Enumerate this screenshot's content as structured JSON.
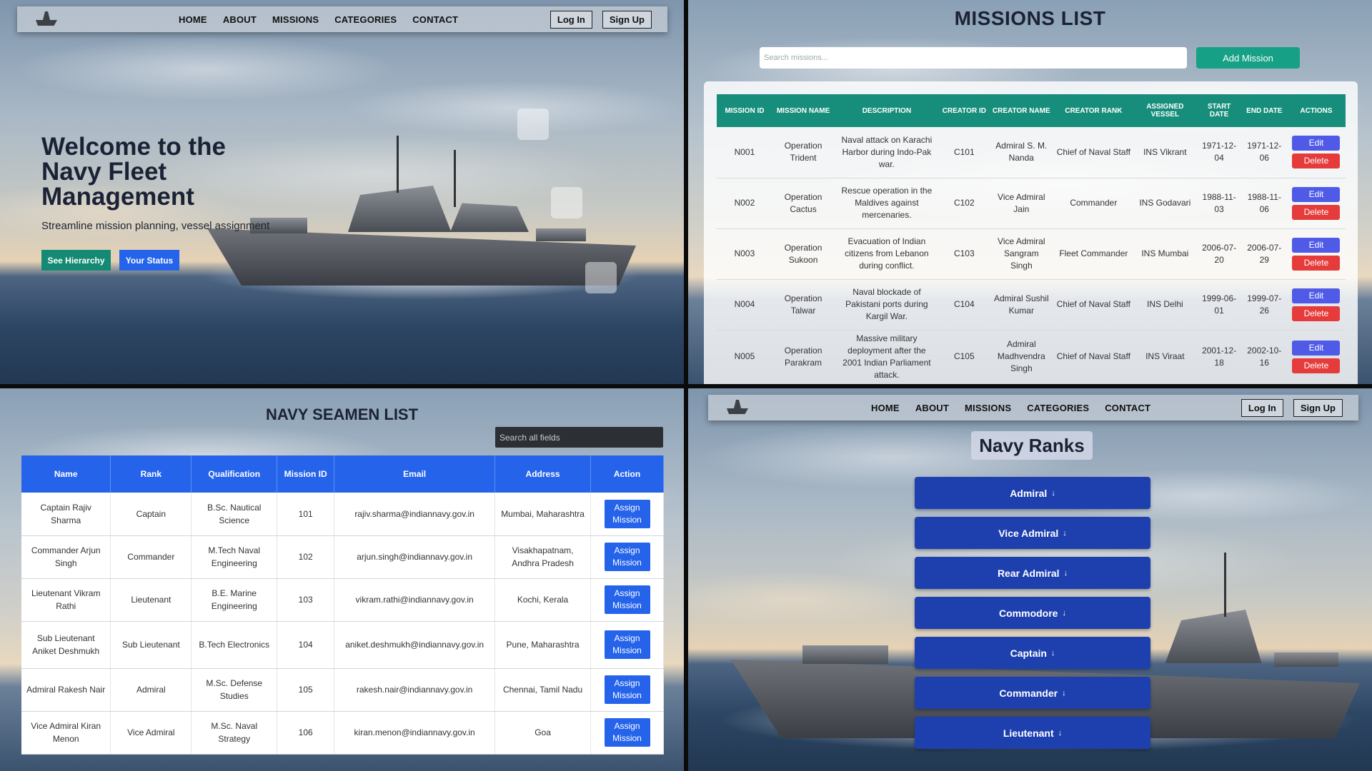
{
  "nav": {
    "links": [
      "HOME",
      "ABOUT",
      "MISSIONS",
      "CATEGORIES",
      "CONTACT"
    ],
    "login": "Log In",
    "signup": "Sign Up"
  },
  "hero": {
    "title": "Welcome to the Navy Fleet Management",
    "subtitle": "Streamline mission planning, vessel assignment",
    "btn_hierarchy": "See Hierarchy",
    "btn_status": "Your Status"
  },
  "missions": {
    "title": "MISSIONS LIST",
    "search_placeholder": "Search missions...",
    "add_label": "Add Mission",
    "headers": [
      "MISSION ID",
      "MISSION NAME",
      "DESCRIPTION",
      "CREATOR ID",
      "CREATOR NAME",
      "CREATOR RANK",
      "ASSIGNED VESSEL",
      "START DATE",
      "END DATE",
      "ACTIONS"
    ],
    "edit_label": "Edit",
    "delete_label": "Delete",
    "rows": [
      [
        "N001",
        "Operation Trident",
        "Naval attack on Karachi Harbor during Indo-Pak war.",
        "C101",
        "Admiral S. M. Nanda",
        "Chief of Naval Staff",
        "INS Vikrant",
        "1971-12-04",
        "1971-12-06"
      ],
      [
        "N002",
        "Operation Cactus",
        "Rescue operation in the Maldives against mercenaries.",
        "C102",
        "Vice Admiral Jain",
        "Commander",
        "INS Godavari",
        "1988-11-03",
        "1988-11-06"
      ],
      [
        "N003",
        "Operation Sukoon",
        "Evacuation of Indian citizens from Lebanon during conflict.",
        "C103",
        "Vice Admiral Sangram Singh",
        "Fleet Commander",
        "INS Mumbai",
        "2006-07-20",
        "2006-07-29"
      ],
      [
        "N004",
        "Operation Talwar",
        "Naval blockade of Pakistani ports during Kargil War.",
        "C104",
        "Admiral Sushil Kumar",
        "Chief of Naval Staff",
        "INS Delhi",
        "1999-06-01",
        "1999-07-26"
      ],
      [
        "N005",
        "Operation Parakram",
        "Massive military deployment after the 2001 Indian Parliament attack.",
        "C105",
        "Admiral Madhvendra Singh",
        "Chief of Naval Staff",
        "INS Viraat",
        "2001-12-18",
        "2002-10-16"
      ]
    ]
  },
  "seamen": {
    "title": "NAVY SEAMEN LIST",
    "search_placeholder": "Search all fields",
    "headers": [
      "Name",
      "Rank",
      "Qualification",
      "Mission ID",
      "Email",
      "Address",
      "Action"
    ],
    "assign_label": "Assign Mission",
    "rows": [
      [
        "Captain Rajiv Sharma",
        "Captain",
        "B.Sc. Nautical Science",
        "101",
        "rajiv.sharma@indiannavy.gov.in",
        "Mumbai, Maharashtra"
      ],
      [
        "Commander Arjun Singh",
        "Commander",
        "M.Tech Naval Engineering",
        "102",
        "arjun.singh@indiannavy.gov.in",
        "Visakhapatnam, Andhra Pradesh"
      ],
      [
        "Lieutenant Vikram Rathi",
        "Lieutenant",
        "B.E. Marine Engineering",
        "103",
        "vikram.rathi@indiannavy.gov.in",
        "Kochi, Kerala"
      ],
      [
        "Sub Lieutenant Aniket Deshmukh",
        "Sub Lieutenant",
        "B.Tech Electronics",
        "104",
        "aniket.deshmukh@indiannavy.gov.in",
        "Pune, Maharashtra"
      ],
      [
        "Admiral Rakesh Nair",
        "Admiral",
        "M.Sc. Defense Studies",
        "105",
        "rakesh.nair@indiannavy.gov.in",
        "Chennai, Tamil Nadu"
      ],
      [
        "Vice Admiral Kiran Menon",
        "Vice Admiral",
        "M.Sc. Naval Strategy",
        "106",
        "kiran.menon@indiannavy.gov.in",
        "Goa"
      ]
    ]
  },
  "ranks": {
    "title": "Navy Ranks",
    "arrow": "↓",
    "items": [
      "Admiral",
      "Vice Admiral",
      "Rear Admiral",
      "Commodore",
      "Captain",
      "Commander",
      "Lieutenant"
    ]
  },
  "colors": {
    "teal": "#16a085",
    "blue": "#2563eb",
    "rank_blue": "#1e40af",
    "edit": "#4f5be6",
    "delete": "#e53b3b"
  }
}
